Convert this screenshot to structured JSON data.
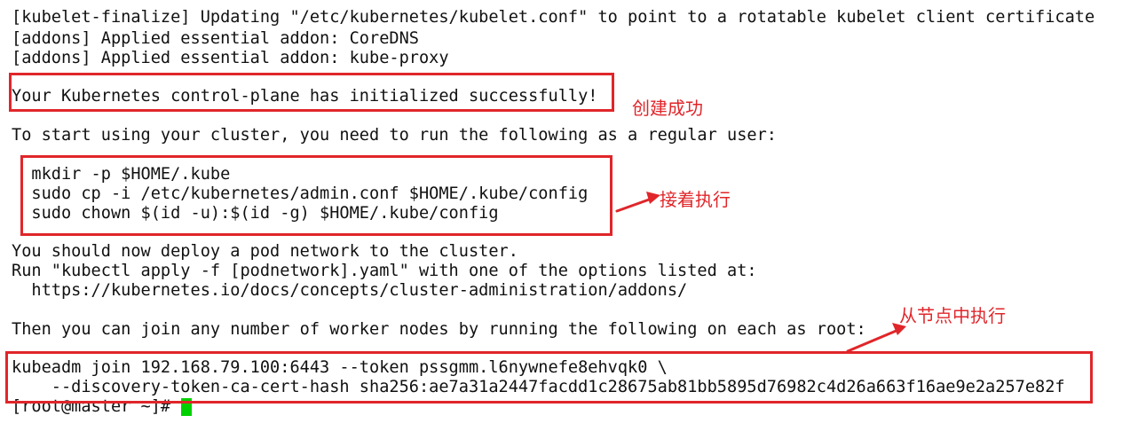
{
  "terminal": {
    "lines": [
      "[kubelet-finalize] Updating \"/etc/kubernetes/kubelet.conf\" to point to a rotatable kubelet client certificate",
      "[addons] Applied essential addon: CoreDNS",
      "[addons] Applied essential addon: kube-proxy",
      "",
      "Your Kubernetes control-plane has initialized successfully!",
      "",
      "To start using your cluster, you need to run the following as a regular user:",
      "",
      "  mkdir -p $HOME/.kube",
      "  sudo cp -i /etc/kubernetes/admin.conf $HOME/.kube/config",
      "  sudo chown $(id -u):$(id -g) $HOME/.kube/config",
      "",
      "You should now deploy a pod network to the cluster.",
      "Run \"kubectl apply -f [podnetwork].yaml\" with one of the options listed at:",
      "  https://kubernetes.io/docs/concepts/cluster-administration/addons/",
      "",
      "Then you can join any number of worker nodes by running the following on each as root:",
      "",
      "kubeadm join 192.168.79.100:6443 --token pssgmm.l6nywnefe8ehvqk0 \\",
      "    --discovery-token-ca-cert-hash sha256:ae7a31a2447facdd1c28675ab81bb5895d76982c4d26a663f16ae9e2a257e82f",
      "[root@master ~]# "
    ]
  },
  "annotations": {
    "success": "创建成功",
    "next": "接着执行",
    "worker": "从节点中执行"
  },
  "colors": {
    "annotation": "#e0262a",
    "cursor": "#00d000",
    "text": "#111111",
    "background": "#ffffff"
  }
}
